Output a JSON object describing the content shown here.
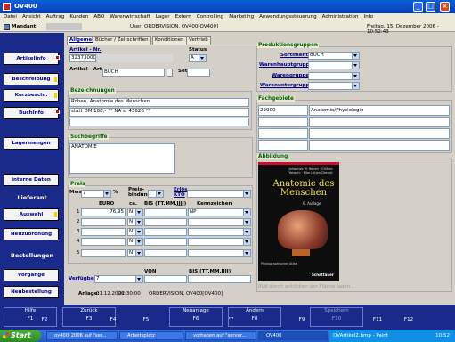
{
  "window": {
    "title": "OV400",
    "min": "_",
    "max": "□",
    "close": "×"
  },
  "menu": [
    "Datei",
    "Ansicht",
    "Auftrag",
    "Kunden",
    "ABO",
    "Warenwirtschaft",
    "Lager",
    "Extern",
    "Controlling",
    "Marketing",
    "Anwendungssteuerung",
    "Administration",
    "Info"
  ],
  "infobar": {
    "mandant_label": "Mandant:",
    "user_text": "User: ORDERVISION, OV400[OV400]",
    "datetime": "Freitag, 15. Dezember 2006 - 10:52:43"
  },
  "sidebar": {
    "buttons": [
      "Artikelinfo",
      "Beschreibung",
      "Kurzbeschr.",
      "Buchinfo",
      "Lagermengen",
      "interne Daten"
    ],
    "section_lieferant": "Lieferant",
    "lieferant_buttons": [
      "Auswahl",
      "Neuzuordnung"
    ],
    "section_bestellungen": "Bestellungen",
    "bestell_buttons": [
      "Vorgänge",
      "Neubestellung"
    ]
  },
  "tabs": [
    "Allgemein",
    "Bücher / Zeitschriften",
    "Konditionen",
    "Vertrieb"
  ],
  "artikel": {
    "nr_label": "Artikel - Nr.",
    "nr_value": "32373000",
    "status_label": "Status",
    "status_value": "A",
    "art_label": "Artikel - Art",
    "art_value": "BUCH",
    "set_label": "Set"
  },
  "bezeichnungen": {
    "title": "Bezeichnungen",
    "line1": "Rohen, Anatomie des Menschen",
    "line2": "statt DM 168,-    ** NA s. 43626 **"
  },
  "suchbegriffe": {
    "title": "Suchbegriffe",
    "value": "ANATOMIE"
  },
  "preis": {
    "title": "Preis",
    "mwst_label": "Mwst",
    "mwst_value": "7",
    "pct": "%",
    "preisbindung_label": "Preis-bindung",
    "preisbindung_value": "J",
    "erloes_label": "Erlös KTO",
    "col_euro": "EURO",
    "col_ca": "ca.",
    "col_bis": "BIS (TT.MM.JJJJ)",
    "col_kenn": "Kennzeichen",
    "rows": [
      {
        "num": "1",
        "euro": "76,95",
        "ca": "N",
        "kenn": "NP"
      },
      {
        "num": "2",
        "euro": "",
        "ca": "N",
        "kenn": ""
      },
      {
        "num": "3",
        "euro": "",
        "ca": "N",
        "kenn": ""
      },
      {
        "num": "4",
        "euro": "",
        "ca": "N",
        "kenn": ""
      },
      {
        "num": "5",
        "euro": "",
        "ca": "N",
        "kenn": ""
      }
    ]
  },
  "verfuegbar": {
    "label": "Verfügbar",
    "value": "7",
    "von_label": "VON",
    "bis_label": "BIS (TT.MM.JJJJ)"
  },
  "anlage": {
    "label": "Anlage:",
    "date": "01.12.2006",
    "time": "22:30:00",
    "user": "ORDERVISION, OV400[OV400]"
  },
  "produktgruppen": {
    "title": "Produktionsgruppen",
    "sortiment_label": "Sortiment",
    "sortiment_value": "BUCH",
    "warenhaupt_label": "Warenhauptgruppe",
    "warengruppe_label": "Warengruppe",
    "warenunter_label": "Warenuntergruppe"
  },
  "fachgebiete": {
    "title": "Fachgebiete",
    "code": "29900",
    "name": "Anatomie/Physiologie"
  },
  "abbildung": {
    "title": "Abbildung",
    "cover_author": "Johannes W. Rohen · Chihiro Yokochi · Elke Lütjen-Drecoll",
    "cover_title": "Anatomie des Menschen",
    "cover_edition": "6. Auflage",
    "cover_subtitle": "Photographischer Atlas",
    "cover_publisher": "Schattauer",
    "hint": "Bild durch anklicken der Fläche laden..."
  },
  "fkeys": [
    {
      "top": "Hilfe",
      "key": "F1"
    },
    {
      "top": "",
      "key": "F2"
    },
    {
      "top": "Zurück",
      "key": "F3"
    },
    {
      "top": "",
      "key": "F4"
    },
    {
      "top": "",
      "key": "F5"
    },
    {
      "top": "Neuanlage",
      "key": "F6"
    },
    {
      "top": "",
      "key": "F7"
    },
    {
      "top": "Ändern",
      "key": "F8"
    },
    {
      "top": "",
      "key": "F9"
    },
    {
      "top": "Speichern",
      "key": "F10"
    },
    {
      "top": "",
      "key": "F11"
    },
    {
      "top": "",
      "key": "F12"
    }
  ],
  "taskbar": {
    "start": "Start",
    "tasks": [
      "ov400_2006 auf \"ser...",
      "Arbeitsplatz",
      "vorhaben auf \"server...",
      "OV400"
    ],
    "tray_task": "OVArtikel2.bmp - Paint",
    "clock": "10:52"
  },
  "colors": {
    "sidebar": "#1a2a8a",
    "link": "#00008b",
    "group_title": "#006000"
  }
}
